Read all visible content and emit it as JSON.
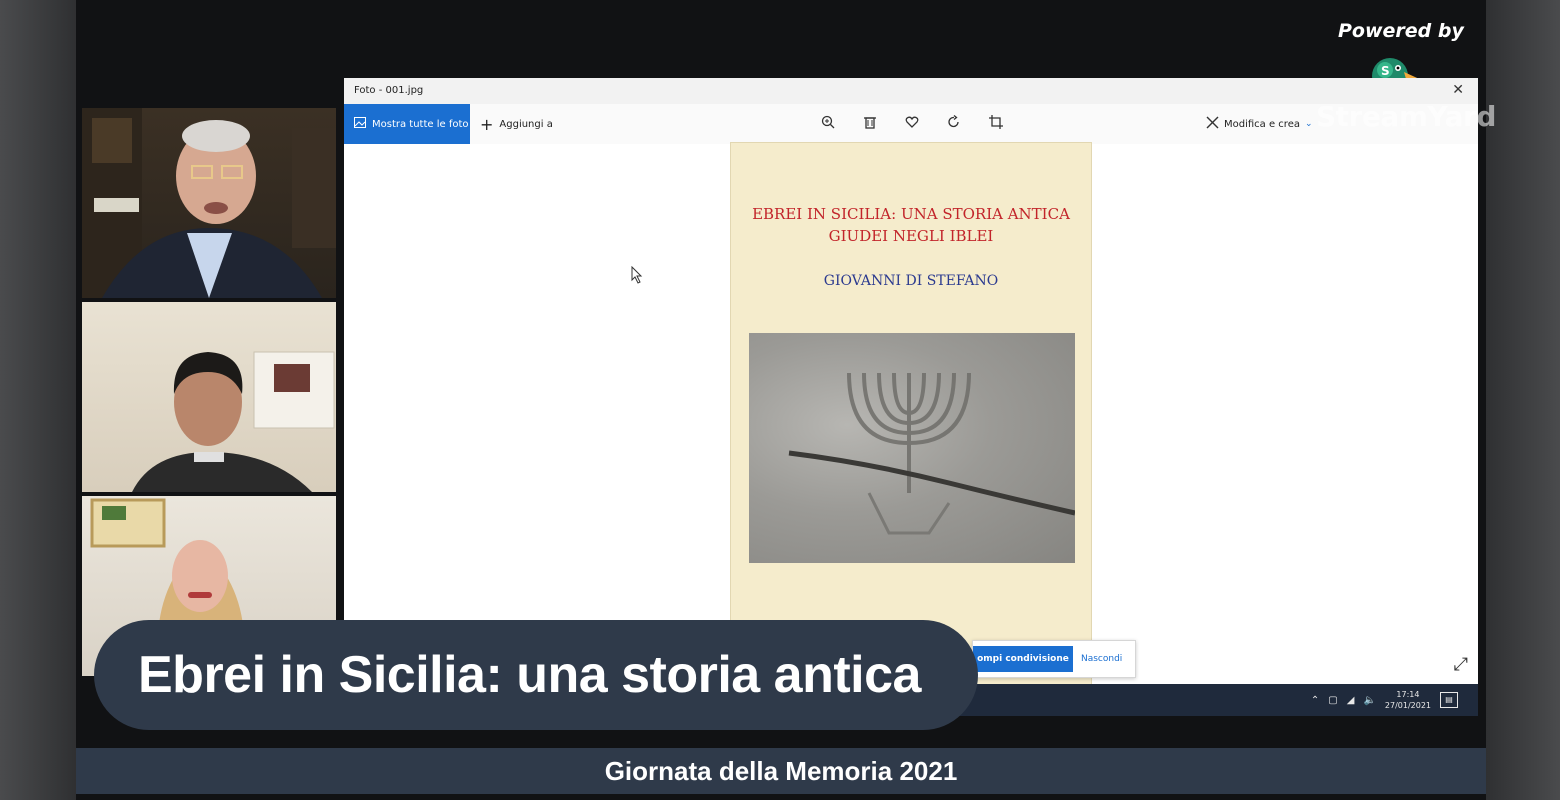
{
  "branding": {
    "powered_by": "Powered by",
    "logo_text": "StreamYard"
  },
  "photos_app": {
    "window_title": "Foto - 001.jpg",
    "toolbar": {
      "show_all_label": "Mostra tutte le foto",
      "add_to_label": "Aggiungi a",
      "edit_create_label": "Modifica e crea",
      "tools": [
        "zoom-in-icon",
        "delete-icon",
        "favorite-icon",
        "rotate-icon",
        "crop-icon"
      ]
    },
    "book_cover": {
      "title_line1": "EBREI IN SICILIA: UNA STORIA ANTICA",
      "title_line2": "GIUDEI NEGLI IBLEI",
      "author": "GIOVANNI DI STEFANO"
    },
    "share_bar": {
      "stop_label": "ompi condivisione",
      "hide_label": "Nascondi"
    },
    "taskbar": {
      "time": "17:14",
      "date": "27/01/2021"
    }
  },
  "lower_third": {
    "title": "Ebrei in Sicilia: una storia antica"
  },
  "ticker": {
    "text": "Giornata della Memoria 2021"
  },
  "colors": {
    "accent_blue": "#1b6fd1",
    "banner_bg": "#2f3a4a",
    "cover_bg": "#f5eccc",
    "cover_title": "#c2242a",
    "cover_author": "#2b3a8f"
  }
}
